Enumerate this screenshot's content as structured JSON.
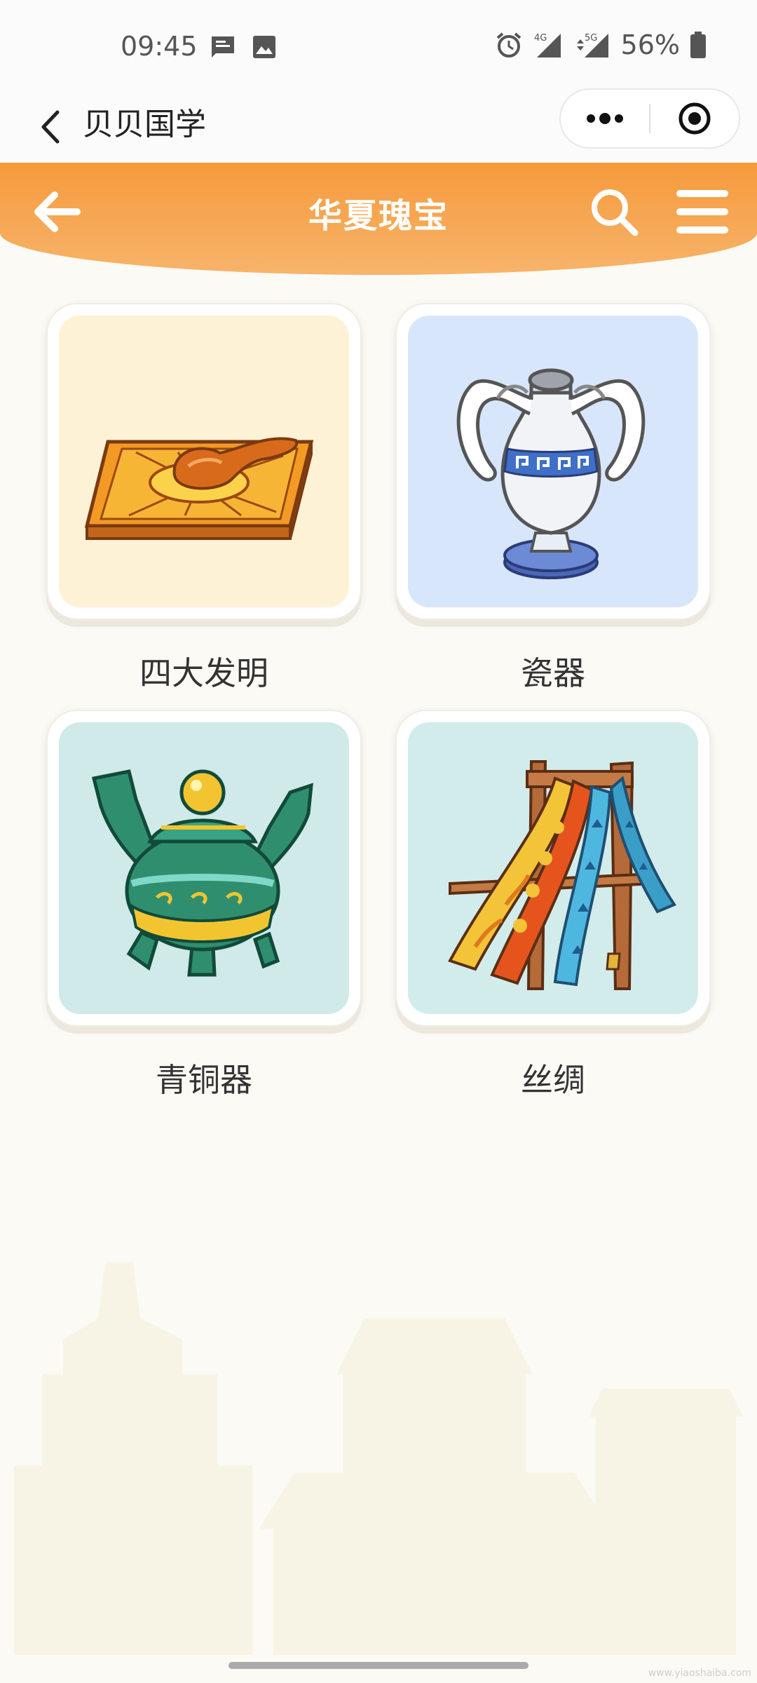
{
  "status_bar": {
    "time": "09:45",
    "icons": [
      "message-icon",
      "image-icon",
      "alarm-icon",
      "signal-4g-icon",
      "signal-5g-icon",
      "battery-icon"
    ],
    "signal_labels": [
      "4G",
      "5G"
    ],
    "battery": "56%"
  },
  "nav": {
    "title": "贝贝国学",
    "back_icon": "chevron-left-icon",
    "capsule_icons": [
      "more-dots-icon",
      "close-target-icon"
    ]
  },
  "header": {
    "title": "华夏瑰宝",
    "icons": [
      "arrow-left-icon",
      "search-icon",
      "menu-icon"
    ],
    "color": "#f59a3c"
  },
  "categories": [
    {
      "label": "四大发明",
      "icon": "compass-sinan-icon",
      "bg": "#fdf2d6"
    },
    {
      "label": "瓷器",
      "icon": "porcelain-vase-icon",
      "bg": "#d8e6fb"
    },
    {
      "label": "青铜器",
      "icon": "bronze-ding-icon",
      "bg": "#cfeae8"
    },
    {
      "label": "丝绸",
      "icon": "silk-rack-icon",
      "bg": "#d2ecec"
    }
  ],
  "watermark": "www.yiaoshaiba.com"
}
